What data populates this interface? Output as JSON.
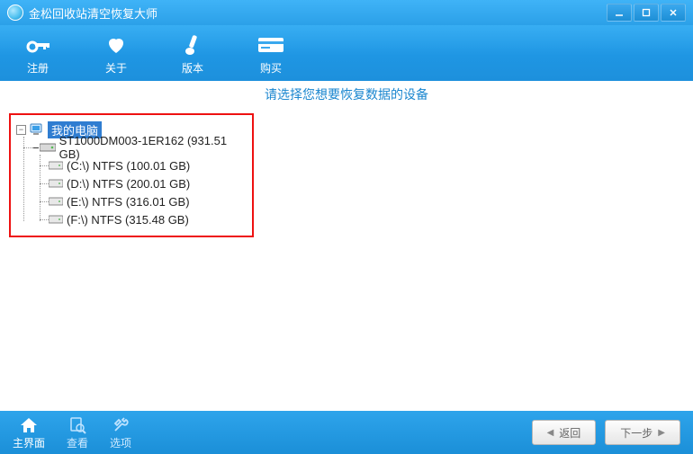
{
  "app": {
    "title": "金松回收站清空恢复大师"
  },
  "toolbar": {
    "register": "注册",
    "about": "关于",
    "version": "版本",
    "buy": "购买"
  },
  "instruction": "请选择您想要恢复数据的设备",
  "tree": {
    "root": "我的电脑",
    "disk": "ST1000DM003-1ER162 (931.51 GB)",
    "partitions": [
      "(C:\\) NTFS (100.01 GB)",
      "(D:\\) NTFS (200.01 GB)",
      "(E:\\) NTFS (316.01 GB)",
      "(F:\\) NTFS (315.48 GB)"
    ]
  },
  "footer": {
    "home": "主界面",
    "view": "查看",
    "options": "选项",
    "back": "返回",
    "next": "下一步"
  }
}
